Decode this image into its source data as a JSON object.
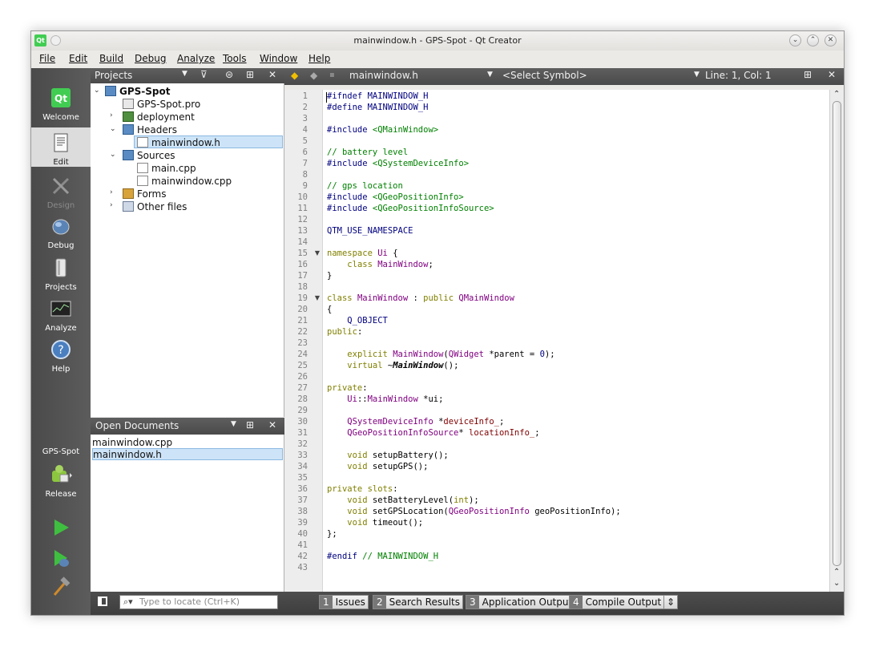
{
  "window": {
    "title": "mainwindow.h - GPS-Spot - Qt Creator",
    "app_icon": "Qt"
  },
  "menu": [
    "File",
    "Edit",
    "Build",
    "Debug",
    "Analyze",
    "Tools",
    "Window",
    "Help"
  ],
  "modes": {
    "welcome": "Welcome",
    "edit": "Edit",
    "design": "Design",
    "debug": "Debug",
    "projects": "Projects",
    "analyze": "Analyze",
    "help": "Help"
  },
  "kit": {
    "project": "GPS-Spot",
    "config": "Release"
  },
  "projects_pane": {
    "title": "Projects",
    "tree": {
      "root": "GPS-Spot",
      "pro": "GPS-Spot.pro",
      "deployment": "deployment",
      "headers": "Headers",
      "header_file": "mainwindow.h",
      "sources": "Sources",
      "source_main": "main.cpp",
      "source_mainwindow": "mainwindow.cpp",
      "forms": "Forms",
      "other": "Other files"
    }
  },
  "open_documents": {
    "title": "Open Documents",
    "items": [
      "mainwindow.cpp",
      "mainwindow.h"
    ],
    "selected": "mainwindow.h"
  },
  "editor_toolbar": {
    "file": "mainwindow.h",
    "symbol": "<Select Symbol>",
    "position": "Line: 1, Col: 1"
  },
  "code": {
    "line_numbers": [
      "1",
      "2",
      "3",
      "4",
      "5",
      "6",
      "7",
      "8",
      "9",
      "10",
      "11",
      "12",
      "13",
      "14",
      "15",
      "16",
      "17",
      "18",
      "19",
      "20",
      "21",
      "22",
      "23",
      "24",
      "25",
      "26",
      "27",
      "28",
      "29",
      "30",
      "31",
      "32",
      "33",
      "34",
      "35",
      "36",
      "37",
      "38",
      "39",
      "40",
      "41",
      "42",
      "43"
    ],
    "colors": {
      "directive": "#000080",
      "keyword": "#808000",
      "type": "#800080",
      "string": "#008000",
      "comment": "#008000",
      "number": "#000080",
      "member": "#800000"
    }
  },
  "statusbar": {
    "locate_placeholder": "Type to locate (Ctrl+K)",
    "tabs": [
      {
        "num": "1",
        "label": "Issues"
      },
      {
        "num": "2",
        "label": "Search Results"
      },
      {
        "num": "3",
        "label": "Application Output"
      },
      {
        "num": "4",
        "label": "Compile Output"
      }
    ]
  }
}
